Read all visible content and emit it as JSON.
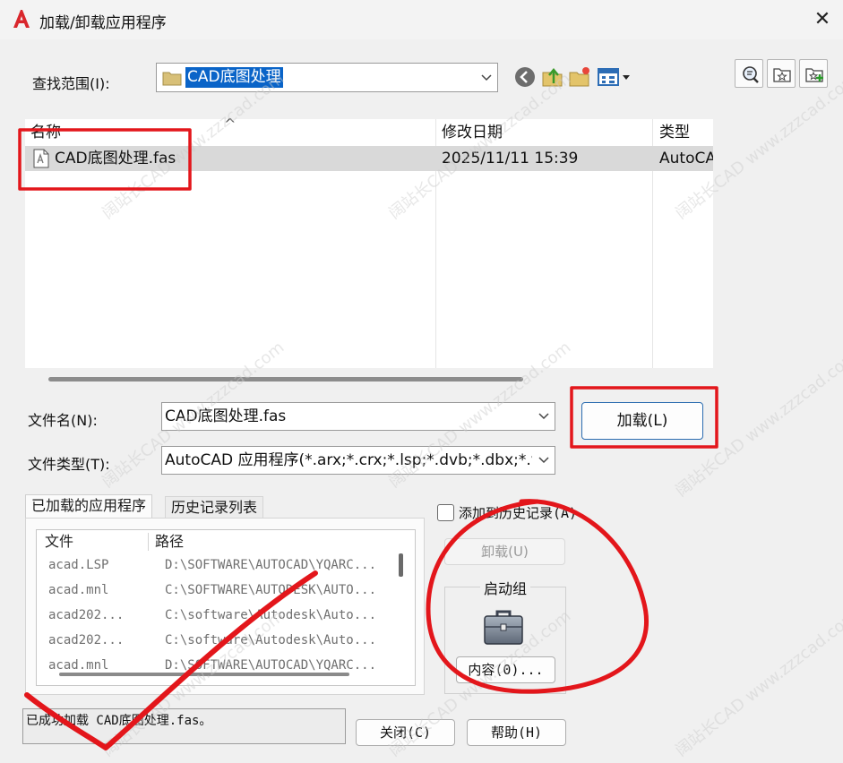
{
  "window": {
    "title": "加载/卸载应用程序",
    "close_glyph": "✕"
  },
  "lookin": {
    "label": "查找范围(I):",
    "value": "CAD底图处理"
  },
  "toolbar_icons": [
    "back-icon",
    "up-folder-icon",
    "new-folder-icon",
    "views-icon"
  ],
  "side_icons": [
    "find-icon",
    "favorites-icon",
    "add-favorite-icon"
  ],
  "filelist": {
    "columns": [
      {
        "label": "名称"
      },
      {
        "label": "修改日期"
      },
      {
        "label": "类型"
      }
    ],
    "sort_glyph": "^",
    "rows": [
      {
        "name": "CAD底图处理.fas",
        "modified": "2025/11/11 15:39",
        "type": "AutoCA"
      }
    ]
  },
  "filename": {
    "label": "文件名(N):",
    "value": "CAD底图处理.fas"
  },
  "filetype": {
    "label": "文件类型(T):",
    "value": "AutoCAD 应用程序(*.arx;*.crx;*.lsp;*.dvb;*.dbx;*.v"
  },
  "load_button": "加载(L)",
  "tabs": [
    {
      "label": "已加载的应用程序",
      "active": true
    },
    {
      "label": "历史记录列表",
      "active": false
    }
  ],
  "loaded_apps": {
    "columns": [
      "文件",
      "路径"
    ],
    "rows": [
      {
        "file": "acad.LSP",
        "path": "D:\\SOFTWARE\\AUTOCAD\\YQARC..."
      },
      {
        "file": "acad.mnl",
        "path": "C:\\SOFTWARE\\AUTODESK\\AUTO..."
      },
      {
        "file": "acad202...",
        "path": "C:\\software\\Autodesk\\Auto..."
      },
      {
        "file": "acad202...",
        "path": "C:\\software\\Autodesk\\Auto..."
      },
      {
        "file": "acad.mnl",
        "path": "D:\\SOFTWARE\\AUTOCAD\\YQARC..."
      }
    ]
  },
  "history_checkbox": {
    "label": "添加到历史记录(A)",
    "checked": false
  },
  "unload_button": "卸载(U)",
  "startup_group": {
    "title": "启动组",
    "contents_button": "内容(0)..."
  },
  "status": "已成功加载 CAD底图处理.fas。",
  "close_button": "关闭(C)",
  "help_button": "帮助(H)",
  "watermark": "阔站长CAD www.zzzcad.com",
  "colors": {
    "accent": "#0a64c8",
    "annotation": "#e3161b",
    "autocad_red": "#d9262c"
  }
}
